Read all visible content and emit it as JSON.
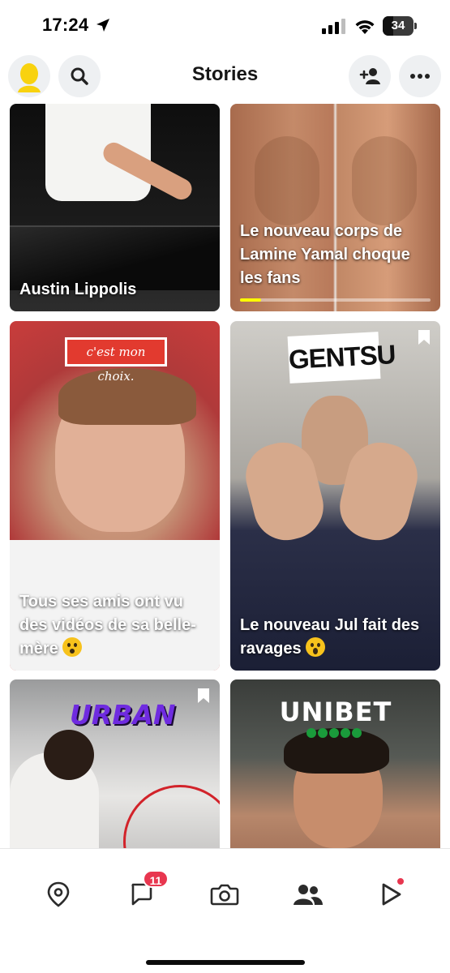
{
  "status_bar": {
    "time": "17:24",
    "battery": "34",
    "battery_level": 0.34,
    "icons": [
      "location-arrow-icon",
      "cellular-signal-icon",
      "wifi-icon",
      "battery-icon"
    ]
  },
  "header": {
    "title": "Stories",
    "left_icons": [
      "bitmoji-avatar-icon",
      "search-icon"
    ],
    "right_icons": [
      "add-friend-icon",
      "more-icon"
    ]
  },
  "cards": [
    {
      "caption": "Austin Lippolis",
      "progress": null,
      "bookmark": false
    },
    {
      "caption": "Le nouveau corps de Lamine Yamal choque les fans",
      "progress": 0.11,
      "bookmark": false
    },
    {
      "caption": "Tous ses amis ont vu des vidéos de sa belle-mère",
      "overlay_label": "c'est mon choix.",
      "emoji": "flushed-face-hands",
      "bookmark": false
    },
    {
      "caption": "Le nouveau Jul fait des ravages",
      "overlay_label": "GENTSU",
      "emoji": "screaming-face",
      "bookmark": true
    },
    {
      "overlay_label": "URBAN",
      "bookmark": true
    },
    {
      "overlay_label": "UNIBET",
      "bookmark": false
    }
  ],
  "tab_bar": {
    "tabs": [
      "map-icon",
      "chat-icon",
      "camera-icon",
      "friends-icon",
      "stories-play-icon"
    ],
    "chat_badge": "11",
    "active_color": "#e8364f"
  },
  "colors": {
    "progress_fill": "#fffc00",
    "avatar": "#f8d20f",
    "badge": "#e8364f"
  }
}
